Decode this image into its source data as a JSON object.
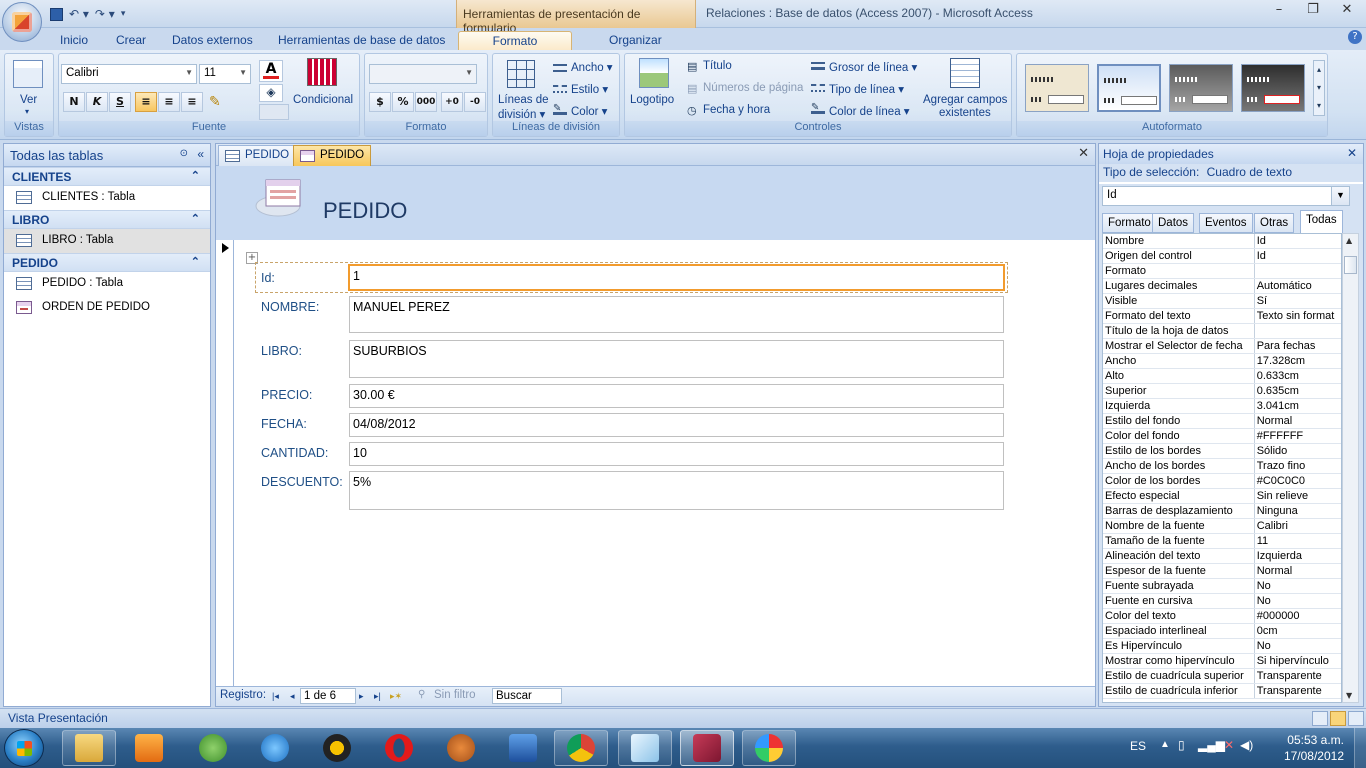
{
  "window": {
    "context_tab_title": "Herramientas de presentación de formulario",
    "title": "Relaciones : Base de datos (Access 2007) - Microsoft Access",
    "minimize": "–",
    "maximize": "❐",
    "close": "✕"
  },
  "ribbon_tabs": [
    "Inicio",
    "Crear",
    "Datos externos",
    "Herramientas de base de datos",
    "Formato",
    "Organizar"
  ],
  "active_ribbon_tab": "Formato",
  "ribbon": {
    "vistas": {
      "label": "Vistas",
      "ver_button": "Ver"
    },
    "fuente": {
      "label": "Fuente",
      "font_name": "Calibri",
      "font_size": "11",
      "bold": "N",
      "italic": "K",
      "underline": "S",
      "condicional": "Condicional"
    },
    "formato": {
      "label": "Formato",
      "format_combo": "",
      "percent": "%",
      "thousands": "000"
    },
    "lineas": {
      "label": "Líneas de división",
      "button_line1": "Líneas de",
      "button_line2": "división ▾",
      "ancho": "Ancho ▾",
      "estilo": "Estilo ▾",
      "color": "Color ▾"
    },
    "controles": {
      "label": "Controles",
      "logotipo": "Logotipo",
      "titulo": "Título",
      "numeros_pagina": "Números de página",
      "fecha_hora": "Fecha y hora",
      "grosor_linea": "Grosor de línea ▾",
      "tipo_linea": "Tipo de línea ▾",
      "color_linea": "Color de línea ▾",
      "agregar_line1": "Agregar campos",
      "agregar_line2": "existentes"
    },
    "autoformato": {
      "label": "Autoformato"
    }
  },
  "nav_pane": {
    "header": "Todas las tablas",
    "groups": [
      {
        "name": "CLIENTES",
        "items": [
          {
            "label": "CLIENTES : Tabla",
            "type": "table"
          }
        ]
      },
      {
        "name": "LIBRO",
        "items": [
          {
            "label": "LIBRO : Tabla",
            "type": "table",
            "selected": true
          }
        ]
      },
      {
        "name": "PEDIDO",
        "items": [
          {
            "label": "PEDIDO : Tabla",
            "type": "table"
          },
          {
            "label": "ORDEN DE PEDIDO",
            "type": "form"
          }
        ]
      }
    ]
  },
  "doc_tabs": [
    {
      "label": "PEDIDO",
      "type": "table",
      "active": false
    },
    {
      "label": "PEDIDO",
      "type": "form",
      "active": true
    }
  ],
  "form": {
    "title": "PEDIDO",
    "fields": [
      {
        "label": "Id:",
        "value": "1"
      },
      {
        "label": "NOMBRE:",
        "value": "MANUEL PEREZ"
      },
      {
        "label": "LIBRO:",
        "value": "SUBURBIOS"
      },
      {
        "label": "PRECIO:",
        "value": "30.00 €"
      },
      {
        "label": "FECHA:",
        "value": "04/08/2012"
      },
      {
        "label": "CANTIDAD:",
        "value": "10"
      },
      {
        "label": "DESCUENTO:",
        "value": "5%"
      }
    ]
  },
  "record_nav": {
    "label": "Registro:",
    "first": "|◂",
    "prev": "◂",
    "position": "1 de 6",
    "next": "▸",
    "last": "▸|",
    "new": "▸✶",
    "filter": "Sin filtro",
    "search": "Buscar"
  },
  "property_sheet": {
    "title": "Hoja de propiedades",
    "selection_type_label": "Tipo de selección:",
    "selection_type_value": "Cuadro de texto",
    "object_combo": "Id",
    "tabs": [
      "Formato",
      "Datos",
      "Eventos",
      "Otras",
      "Todas"
    ],
    "active_tab": "Todas",
    "rows": [
      {
        "name": "Nombre",
        "value": "Id"
      },
      {
        "name": "Origen del control",
        "value": "Id"
      },
      {
        "name": "Formato",
        "value": ""
      },
      {
        "name": "Lugares decimales",
        "value": "Automático"
      },
      {
        "name": "Visible",
        "value": "Sí"
      },
      {
        "name": "Formato del texto",
        "value": "Texto sin format"
      },
      {
        "name": "Título de la hoja de datos",
        "value": ""
      },
      {
        "name": "Mostrar el Selector de fecha",
        "value": "Para fechas"
      },
      {
        "name": "Ancho",
        "value": "17.328cm"
      },
      {
        "name": "Alto",
        "value": "0.633cm"
      },
      {
        "name": "Superior",
        "value": "0.635cm"
      },
      {
        "name": "Izquierda",
        "value": "3.041cm"
      },
      {
        "name": "Estilo del fondo",
        "value": "Normal"
      },
      {
        "name": "Color del fondo",
        "value": "#FFFFFF"
      },
      {
        "name": "Estilo de los bordes",
        "value": "Sólido"
      },
      {
        "name": "Ancho de los bordes",
        "value": "Trazo fino"
      },
      {
        "name": "Color de los bordes",
        "value": "#C0C0C0"
      },
      {
        "name": "Efecto especial",
        "value": "Sin relieve"
      },
      {
        "name": "Barras de desplazamiento",
        "value": "Ninguna"
      },
      {
        "name": "Nombre de la fuente",
        "value": "Calibri"
      },
      {
        "name": "Tamaño de la fuente",
        "value": "11"
      },
      {
        "name": "Alineación del texto",
        "value": "Izquierda"
      },
      {
        "name": "Espesor de la fuente",
        "value": "Normal"
      },
      {
        "name": "Fuente subrayada",
        "value": "No"
      },
      {
        "name": "Fuente en cursiva",
        "value": "No"
      },
      {
        "name": "Color del texto",
        "value": "#000000"
      },
      {
        "name": "Espaciado interlineal",
        "value": "0cm"
      },
      {
        "name": "Es Hipervínculo",
        "value": "No"
      },
      {
        "name": "Mostrar como hipervínculo",
        "value": "Si hipervínculo"
      },
      {
        "name": "Estilo de cuadrícula superior",
        "value": "Transparente"
      },
      {
        "name": "Estilo de cuadrícula inferior",
        "value": "Transparente"
      }
    ]
  },
  "status_bar": {
    "text": "Vista Presentación"
  },
  "taskbar": {
    "apps": [
      "explorer",
      "media-player",
      "people",
      "internet-explorer",
      "winamp",
      "opera",
      "gimp",
      "stocks",
      "chrome",
      "notepad",
      "access",
      "paint"
    ],
    "language": "ES",
    "time": "05:53 a.m.",
    "date": "17/08/2012"
  },
  "colors": {
    "accent_orange": "#f29b2d",
    "ribbon_blue": "#d2e1f2",
    "form_header": "#c7d9f1",
    "label_blue": "#1f4f86"
  }
}
